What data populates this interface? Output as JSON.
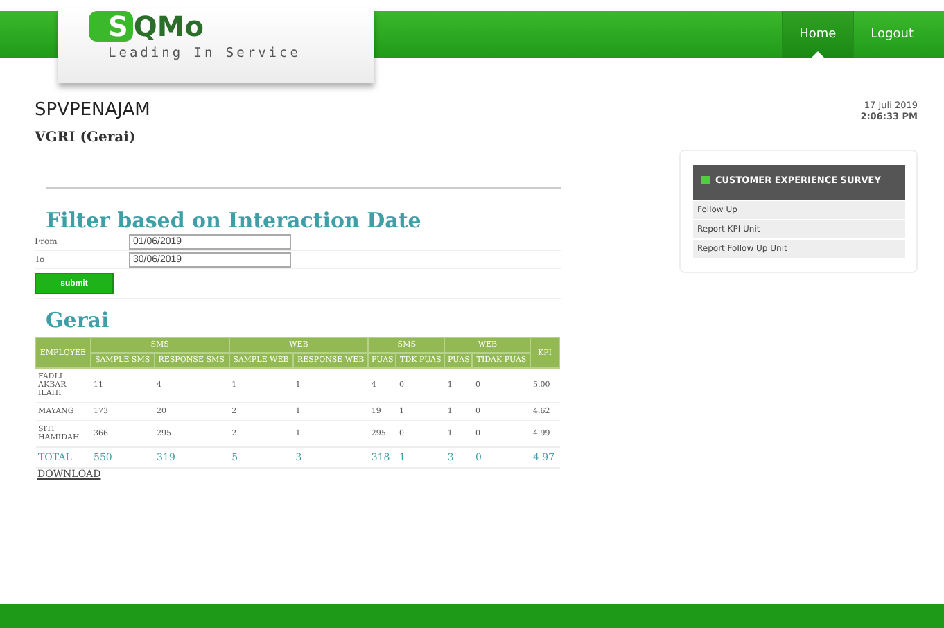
{
  "logo": {
    "name_part_1": "S",
    "name_part_2": "QMo",
    "tagline": "Leading In Service"
  },
  "nav": [
    {
      "label": "Home",
      "selected": true
    },
    {
      "label": "Logout",
      "selected": false
    }
  ],
  "user": "SPVPENAJAM",
  "unit": "VGRI (Gerai)",
  "date": "17 Juli 2019",
  "time": "2:06:33 PM",
  "filter": {
    "title": "Filter based on Interaction Date",
    "fields": [
      {
        "label": "From",
        "value": "01/06/2019"
      },
      {
        "label": "To",
        "value": "30/06/2019"
      }
    ],
    "submit": "submit"
  },
  "table": {
    "title": "Gerai",
    "column_groups": [
      "SMS",
      "WEB",
      "SMS",
      "WEB"
    ],
    "columns": [
      "EMPLOYEE",
      "SAMPLE SMS",
      "RESPONSE SMS",
      "SAMPLE WEB",
      "RESPONSE WEB",
      "PUAS",
      "TDK PUAS",
      "PUAS",
      "TIDAK PUAS",
      "KPI"
    ],
    "rows": [
      [
        "FADLI AKBAR ILAHI",
        "11",
        "4",
        "1",
        "1",
        "4",
        "0",
        "1",
        "0",
        "5.00"
      ],
      [
        "MAYANG",
        "173",
        "20",
        "2",
        "1",
        "19",
        "1",
        "1",
        "0",
        "4.62"
      ],
      [
        "SITI HAMIDAH",
        "366",
        "295",
        "2",
        "1",
        "295",
        "0",
        "1",
        "0",
        "4.99"
      ]
    ],
    "total": [
      "TOTAL",
      "550",
      "319",
      "5",
      "3",
      "318",
      "1",
      "3",
      "0",
      "4.97"
    ],
    "download": "DOWNLOAD"
  },
  "menu": {
    "title": "CUSTOMER EXPERIENCE SURVEY",
    "items": [
      "Follow Up",
      "Report KPI Unit",
      "Report Follow Up Unit"
    ]
  }
}
